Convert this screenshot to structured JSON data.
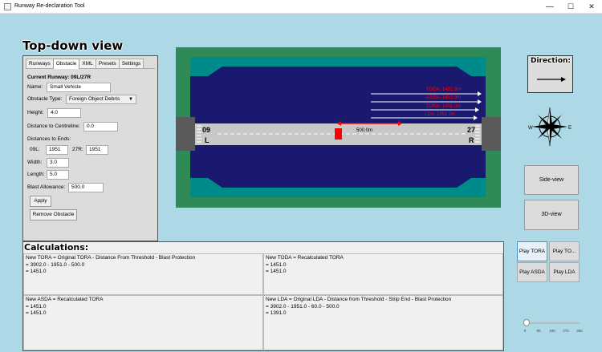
{
  "window": {
    "title": "Runway Re-declaration Tool",
    "minimize": "—",
    "maximize": "☐",
    "close": "✕"
  },
  "headings": {
    "top_down": "Top-down view",
    "calculations": "Calculations:",
    "direction": "Direction:"
  },
  "tabs": [
    "Runways",
    "Obstacle",
    "XML",
    "Presets",
    "Settings"
  ],
  "obstacle_form": {
    "current_runway": "Current Runway: 09L/27R",
    "name_label": "Name:",
    "name_value": "Small Vehicle",
    "type_label": "Obstacle Type:",
    "type_value": "Foreign Object Debris",
    "height_label": "Height:",
    "height_value": "4.0",
    "centreline_label": "Distance to Centreline:",
    "centreline_value": "0.0",
    "ends_label": "Distances to Ends:",
    "end_a_label": "09L:",
    "end_a_value": "1951",
    "end_b_label": "27R:",
    "end_b_value": "1951",
    "width_label": "Width:",
    "width_value": "3.0",
    "length_label": "Length:",
    "length_value": "5.0",
    "blast_label": "Blast Allowance:",
    "blast_value": "500.0",
    "apply": "Apply",
    "remove": "Remove Obstacle"
  },
  "runway": {
    "left_number": "09",
    "left_letter": "L",
    "right_number": "27",
    "right_letter": "R",
    "blast_distance": "500.0m",
    "arrow_labels": [
      "TODA: 1451.0m",
      "ASDA: 1451.0m",
      "TORA: 1451.0m",
      "LDA: 1391.0m"
    ],
    "colors": {
      "grass": "#2e8b57",
      "clearway": "#008b8b",
      "graded_area": "#191970",
      "runway": "#c8c8c8",
      "stopway": "#5a5a5a",
      "obstacle": "#ff0000",
      "label": "#ff0000"
    }
  },
  "side_buttons": {
    "side_view": "Side-view",
    "three_d_view": "3D-view"
  },
  "calculations": [
    {
      "lines": [
        "New TORA = Original TORA  - Distance From Threshold  - Blast Protection",
        "= 3902.0  - 1951.0  - 500.0",
        "= 1451.0"
      ]
    },
    {
      "lines": [
        "New TODA = Recalculated TORA",
        "= 1451.0",
        "= 1451.0"
      ]
    },
    {
      "lines": [
        "New ASDA = Recalculated TORA",
        "= 1451.0",
        "= 1451.0"
      ]
    },
    {
      "lines": [
        "New LDA = Original LDA  - Distance from Threshold  - Strip End  - Blast Protection",
        "= 3902.0  - 1951.0  - 60.0  - 500.0",
        "= 1391.0"
      ]
    }
  ],
  "play_buttons": [
    "Play TORA",
    "Play TO...",
    "Play ASDA",
    "Play LDA"
  ],
  "slider": {
    "value": 0,
    "ticks": [
      "0",
      "90",
      "180",
      "270",
      "360"
    ]
  },
  "compass": {
    "west": "W",
    "east": "E"
  }
}
